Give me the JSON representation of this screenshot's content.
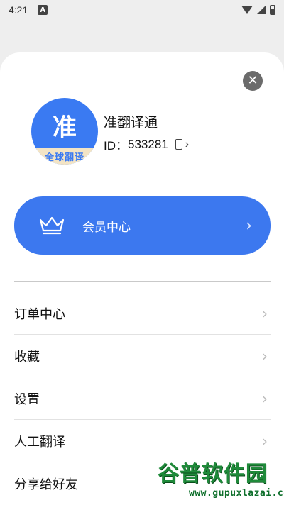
{
  "status_bar": {
    "time": "4:21",
    "notification_letter": "A"
  },
  "profile": {
    "avatar_char": "准",
    "avatar_band_text": "全球翻译",
    "app_name": "准翻译通",
    "id_label": "ID：",
    "id_value": "533281"
  },
  "member_banner": {
    "label": "会员中心",
    "icon": "crown-icon"
  },
  "menu": {
    "items": [
      {
        "label": "订单中心"
      },
      {
        "label": "收藏"
      },
      {
        "label": "设置"
      },
      {
        "label": "人工翻译"
      },
      {
        "label": "分享给好友"
      }
    ]
  },
  "watermark": {
    "title": "谷普软件园",
    "url": "www.gupuxlazai.com"
  },
  "colors": {
    "accent": "#3c78ef",
    "close_button": "#6b6b6b",
    "watermark_green": "#1f8a3a"
  }
}
